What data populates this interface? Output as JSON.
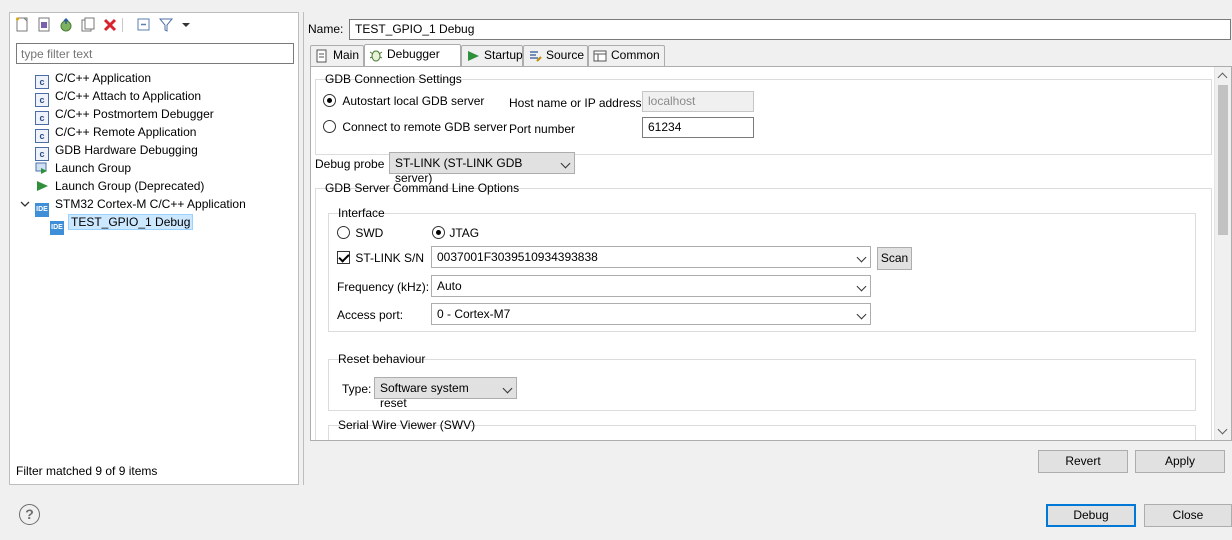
{
  "left": {
    "filter_placeholder": "type filter text",
    "tree": [
      {
        "label": "C/C++ Application",
        "icon": "c-file-icon"
      },
      {
        "label": "C/C++ Attach to Application",
        "icon": "c-file-icon"
      },
      {
        "label": "C/C++ Postmortem Debugger",
        "icon": "c-file-icon"
      },
      {
        "label": "C/C++ Remote Application",
        "icon": "c-file-icon"
      },
      {
        "label": "GDB Hardware Debugging",
        "icon": "c-file-icon"
      },
      {
        "label": "Launch Group",
        "icon": "launch-group-icon"
      },
      {
        "label": "Launch Group (Deprecated)",
        "icon": "launch-group-deprecated-icon"
      },
      {
        "label": "STM32 Cortex-M C/C++ Application",
        "icon": "ide-icon"
      },
      {
        "label": "TEST_GPIO_1 Debug",
        "icon": "ide-icon"
      }
    ],
    "status": "Filter matched 9 of 9 items"
  },
  "right": {
    "name_label": "Name:",
    "name_value": "TEST_GPIO_1 Debug",
    "tabs": [
      "Main",
      "Debugger",
      "Startup",
      "Source",
      "Common"
    ],
    "gdb_connection": {
      "title": "GDB Connection Settings",
      "autostart_label": "Autostart local GDB server",
      "remote_label": "Connect to remote GDB server",
      "host_label": "Host name or IP address",
      "host_value": "localhost",
      "port_label": "Port number",
      "port_value": "61234"
    },
    "debug_probe": {
      "label": "Debug probe",
      "value": "ST-LINK (ST-LINK GDB server)"
    },
    "server_options": {
      "title": "GDB Server Command Line Options",
      "interface_title": "Interface",
      "swd_label": "SWD",
      "jtag_label": "JTAG",
      "stlink_sn_label": "ST-LINK S/N",
      "stlink_sn_value": "0037001F3039510934393838",
      "scan_label": "Scan",
      "frequency_label": "Frequency (kHz):",
      "frequency_value": "Auto",
      "access_port_label": "Access port:",
      "access_port_value": "0 - Cortex-M7",
      "reset_title": "Reset behaviour",
      "type_label": "Type:",
      "type_value": "Software system reset",
      "swv_title": "Serial Wire Viewer (SWV)"
    },
    "revert_label": "Revert",
    "apply_label": "Apply"
  },
  "footer": {
    "debug_label": "Debug",
    "close_label": "Close"
  },
  "colors": {
    "accent": "#0078d7",
    "selection": "#cce8ff",
    "delete_red": "#d9232a"
  }
}
